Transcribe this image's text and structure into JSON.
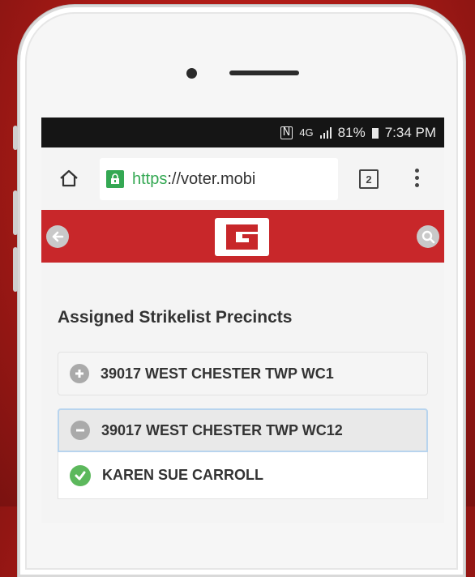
{
  "status_bar": {
    "battery": "81%",
    "time": "7:34 PM",
    "network": "4G"
  },
  "browser": {
    "url_scheme": "https",
    "url_rest": "://voter.mobi",
    "tab_count": "2"
  },
  "app": {
    "brand_color": "#c8272a"
  },
  "section_title": "Assigned Strikelist Precincts",
  "precincts": [
    {
      "label": "39017 WEST CHESTER TWP WC1",
      "expanded": false
    },
    {
      "label": "39017 WEST CHESTER TWP WC12",
      "expanded": true
    }
  ],
  "voters": [
    {
      "name": "KAREN SUE CARROLL",
      "status": "check"
    }
  ],
  "icons": {
    "home": "home-icon",
    "lock": "lock-icon",
    "tabs": "tabs-icon",
    "menu": "more-vert-icon",
    "back": "back-arrow-icon",
    "search": "search-icon",
    "expand": "plus-circle-icon",
    "collapse": "minus-circle-icon",
    "check": "check-circle-icon"
  }
}
